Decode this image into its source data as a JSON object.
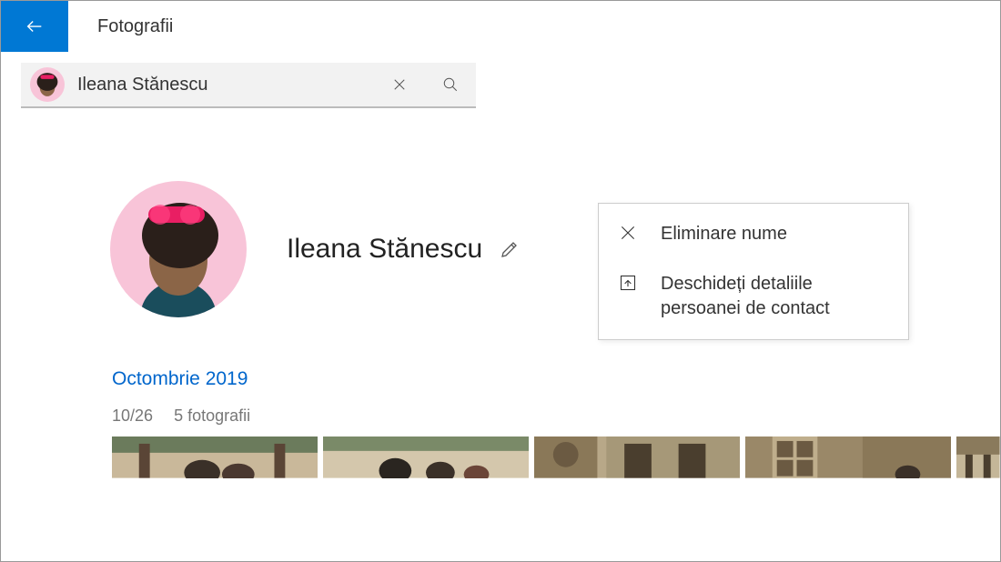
{
  "header": {
    "title": "Fotografii"
  },
  "search": {
    "value": "Ileana Stănescu"
  },
  "profile": {
    "name": "Ileana Stănescu"
  },
  "context_menu": {
    "items": [
      {
        "label": "Eliminare nume",
        "icon": "close-icon"
      },
      {
        "label": "Deschideți detaliile persoanei de contact",
        "icon": "open-contact-icon"
      }
    ]
  },
  "date_section": {
    "month_label": "Octombrie 2019",
    "date": "10/26",
    "count_label": "5 fotografii"
  }
}
